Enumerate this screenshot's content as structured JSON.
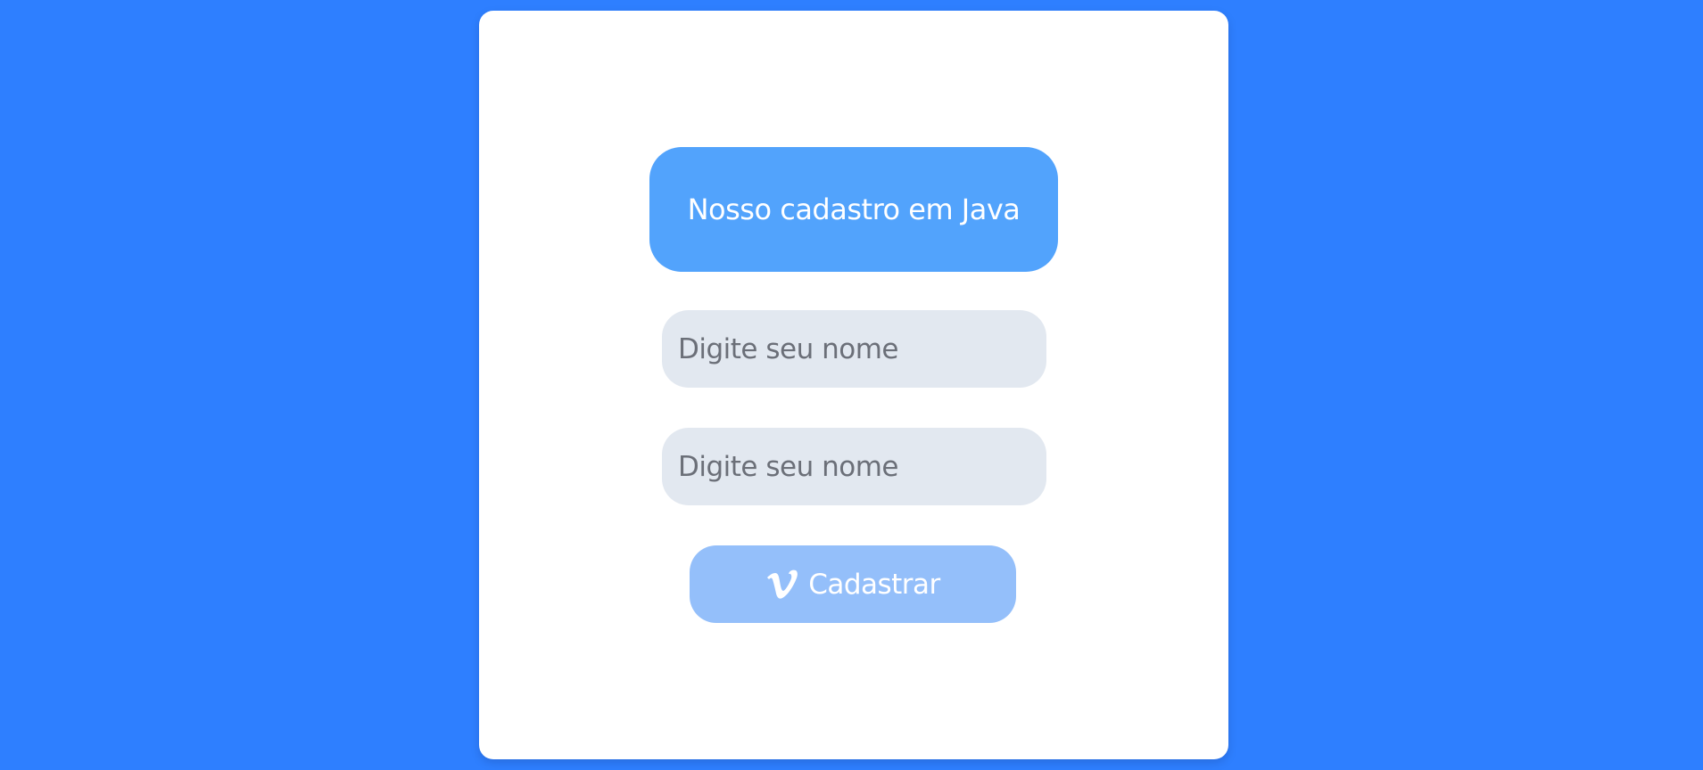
{
  "page": {
    "background_color": "#2e7fff"
  },
  "card": {
    "title": "Nosso cadastro em Java"
  },
  "form": {
    "fields": [
      {
        "placeholder": "Digite seu nome",
        "value": ""
      },
      {
        "placeholder": "Digite seu nome",
        "value": ""
      }
    ],
    "submit": {
      "icon": "vimeo-icon",
      "label": "Cadastrar"
    }
  },
  "colors": {
    "title_box": "#52a3fc",
    "input_bg": "#e2e8f0",
    "button_bg": "#94bffa",
    "card_bg": "#ffffff"
  }
}
